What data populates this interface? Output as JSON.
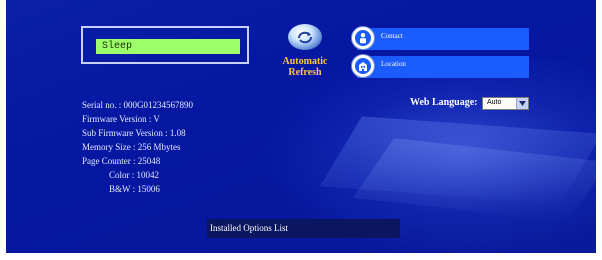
{
  "status": {
    "text": "Sleep"
  },
  "refresh": {
    "label_line1": "Automatic",
    "label_line2": "Refresh",
    "icon": "refresh-icon"
  },
  "nav": [
    {
      "label": "Contact",
      "icon": "contact-icon"
    },
    {
      "label": "Location",
      "icon": "location-icon"
    }
  ],
  "info": {
    "serial": "Serial no. : 000G01234567890",
    "firmware": "Firmware Version : V",
    "sub_firmware": "Sub Firmware Version : 1.08",
    "memory": "Memory Size : 256 Mbytes",
    "page_counter": "Page Counter : 25048",
    "color": "Color : 10042",
    "bw": "B&W : 15006"
  },
  "language": {
    "label": "Web Language:",
    "selected": "Auto"
  },
  "options": {
    "label": "Installed Options List"
  },
  "colors": {
    "background": "#0516a0",
    "button": "#1a5cff",
    "lcd": "#9dff6a",
    "refresh_text": "#ffc83a"
  }
}
